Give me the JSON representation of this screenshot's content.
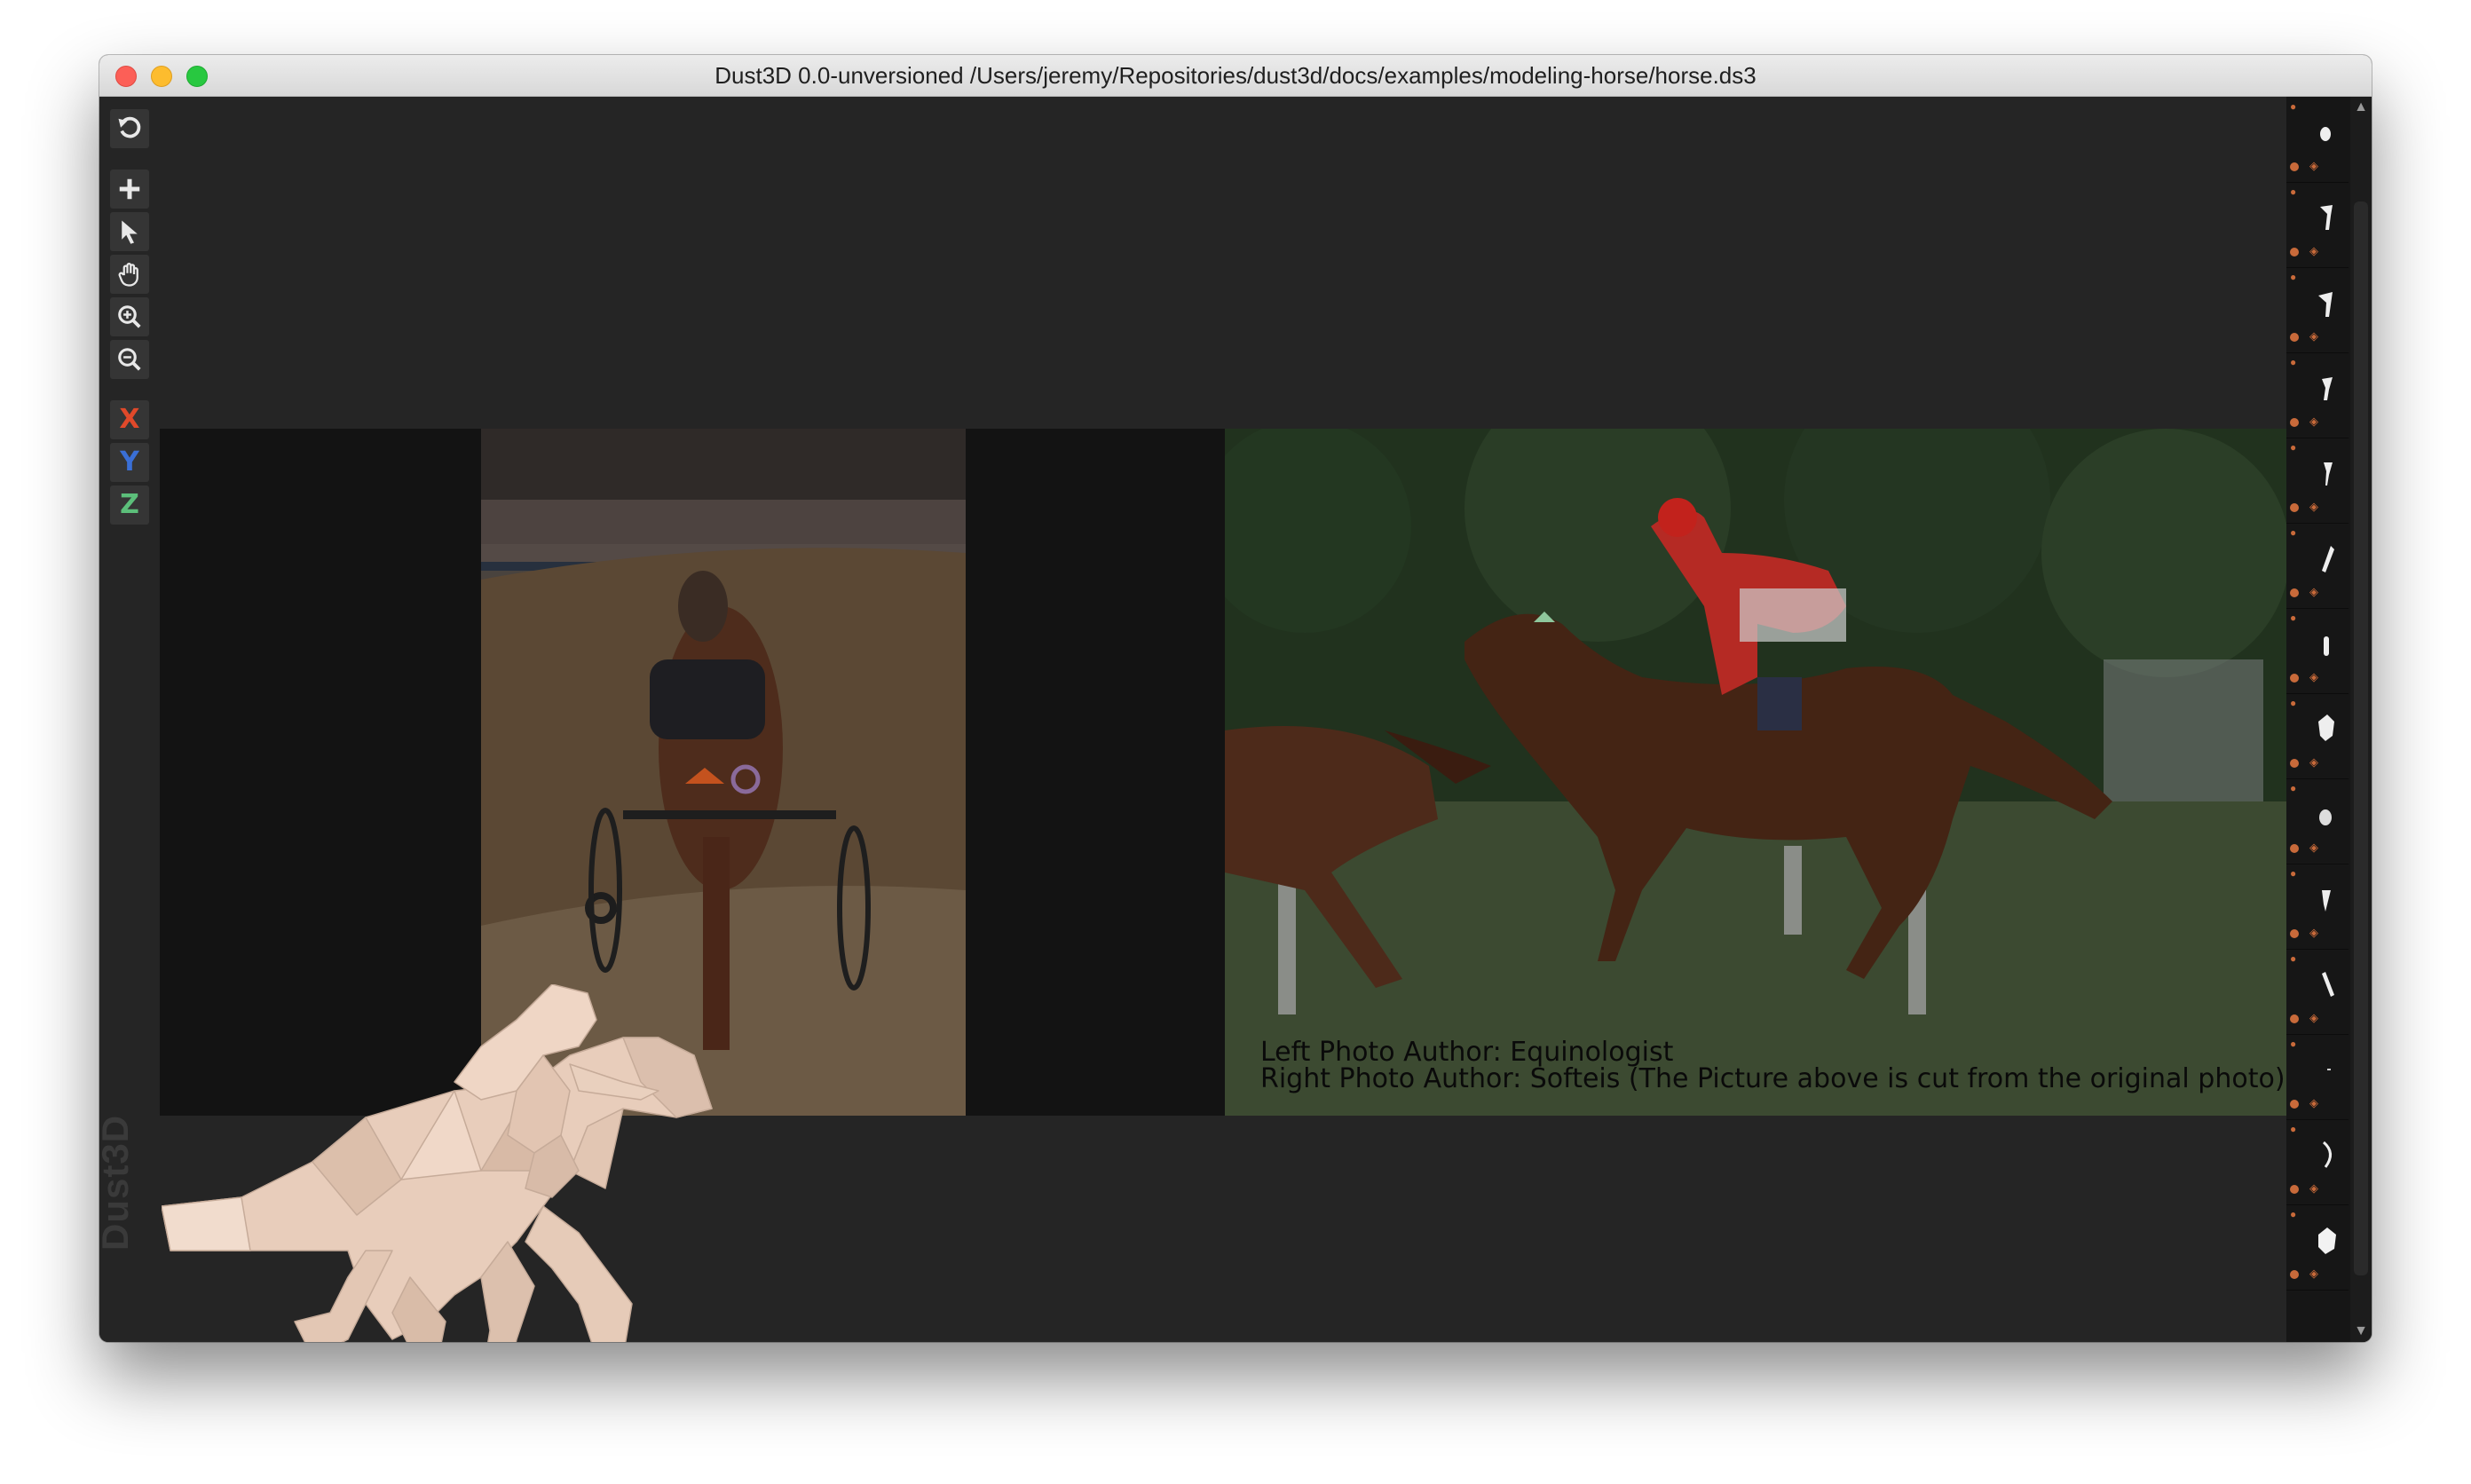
{
  "window": {
    "title": "Dust3D 0.0-unversioned /Users/jeremy/Repositories/dust3d/docs/examples/modeling-horse/horse.ds3"
  },
  "toolbar": {
    "tools": [
      {
        "name": "undo-icon"
      },
      {
        "name": "add-icon"
      },
      {
        "name": "select-icon"
      },
      {
        "name": "hand-icon"
      },
      {
        "name": "zoom-in-icon"
      },
      {
        "name": "zoom-out-icon"
      }
    ],
    "axes": {
      "x": {
        "label": "X",
        "color": "#e0492a"
      },
      "y": {
        "label": "Y",
        "color": "#3a6fd6"
      },
      "z": {
        "label": "Z",
        "color": "#5cbf7a"
      }
    }
  },
  "watermark": "Dust3D",
  "reference": {
    "credit_left": "Left Photo Author: Equinologist",
    "credit_right": "Right Photo Author: Softeis (The Picture above is cut from the original photo)"
  },
  "colors": {
    "background": "#252525",
    "reference_dark": "#131313",
    "model_fill": "#e6cbb8",
    "accent": "#c86a3a"
  }
}
